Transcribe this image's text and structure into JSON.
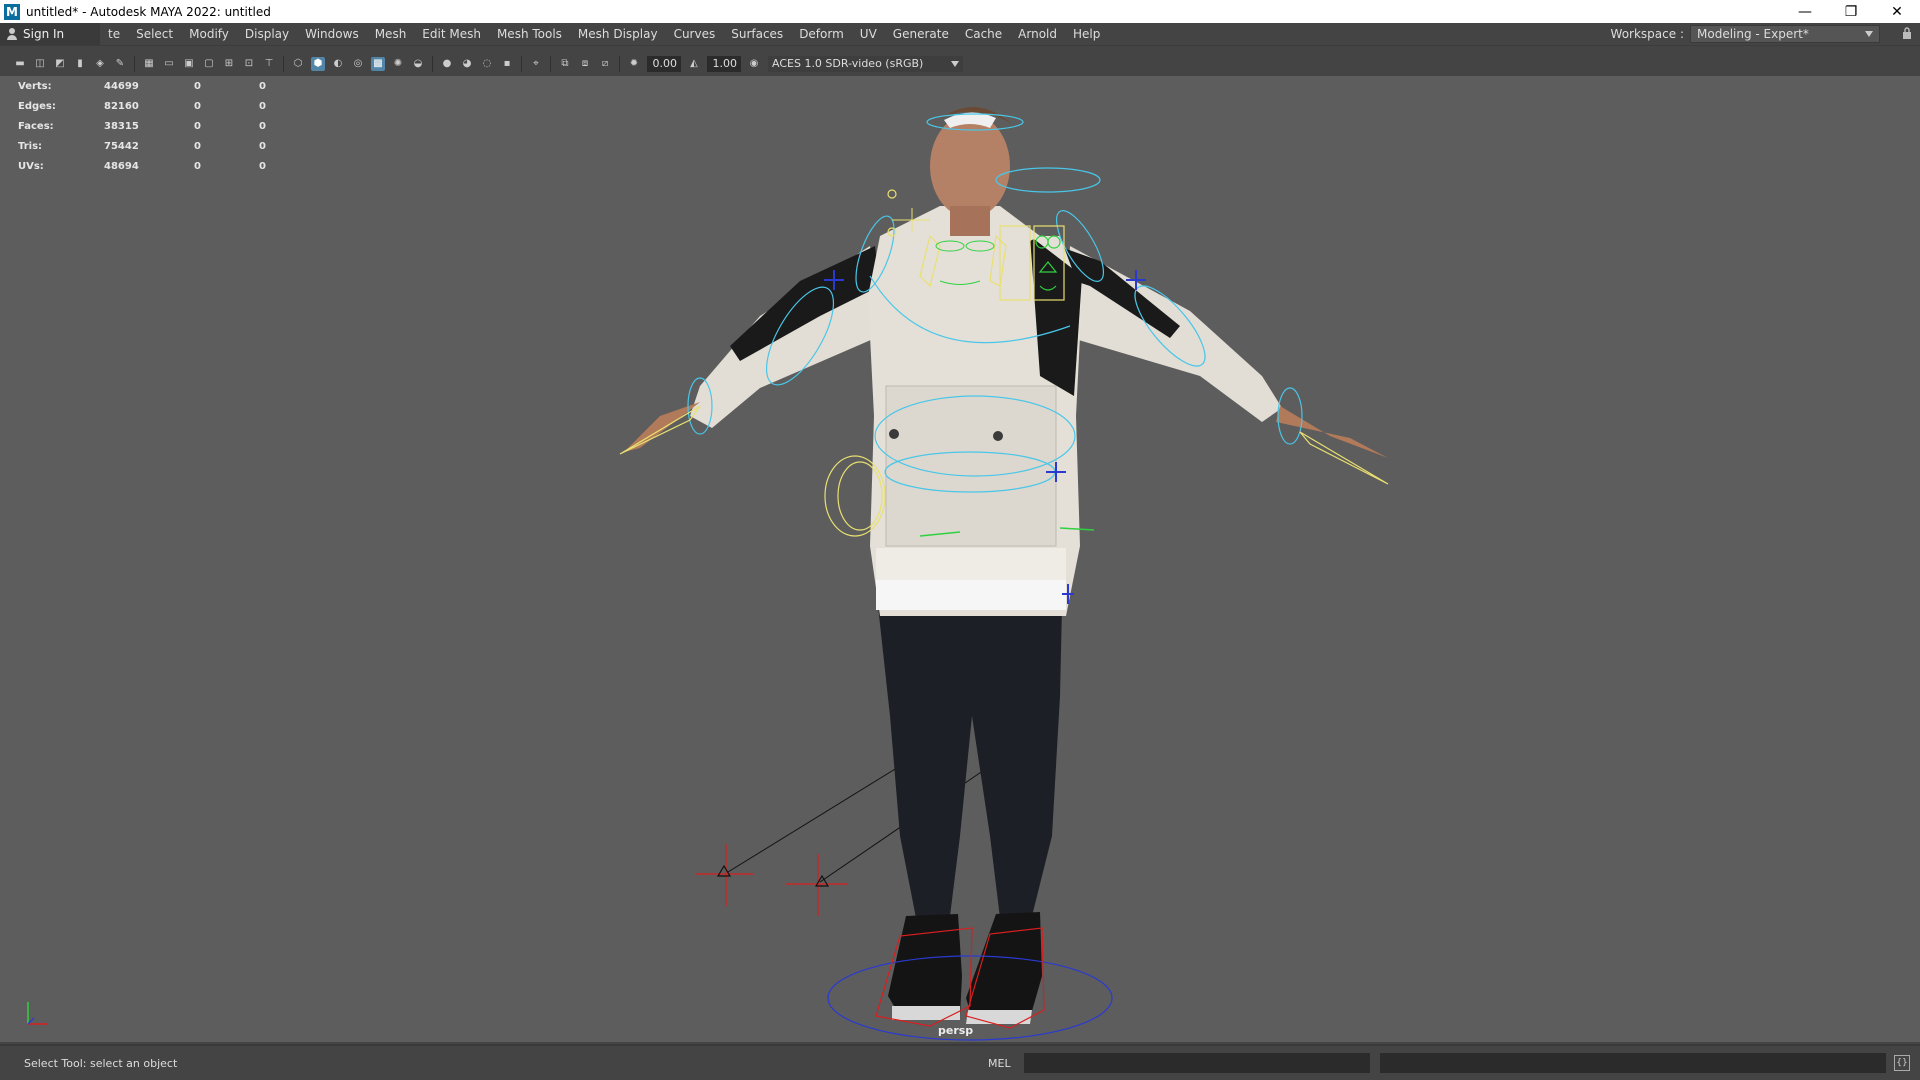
{
  "window": {
    "title": "untitled* - Autodesk MAYA 2022: untitled",
    "icon_glyph": "M",
    "minimize": "—",
    "restore": "❐",
    "close": "✕"
  },
  "menubar": {
    "sign_in": "Sign In",
    "items": [
      "te",
      "Select",
      "Modify",
      "Display",
      "Windows",
      "Mesh",
      "Edit Mesh",
      "Mesh Tools",
      "Mesh Display",
      "Curves",
      "Surfaces",
      "Deform",
      "UV",
      "Generate",
      "Cache",
      "Arnold",
      "Help"
    ],
    "workspace_label": "Workspace :",
    "workspace_value": "Modeling - Expert*"
  },
  "toolbar": {
    "exposure": "0.00",
    "gamma": "1.00",
    "color_space": "ACES 1.0 SDR-video (sRGB)"
  },
  "hud": {
    "rows": [
      {
        "label": "Verts:",
        "v1": "44699",
        "v2": "0",
        "v3": "0"
      },
      {
        "label": "Edges:",
        "v1": "82160",
        "v2": "0",
        "v3": "0"
      },
      {
        "label": "Faces:",
        "v1": "38315",
        "v2": "0",
        "v3": "0"
      },
      {
        "label": "Tris:",
        "v1": "75442",
        "v2": "0",
        "v3": "0"
      },
      {
        "label": "UVs:",
        "v1": "48694",
        "v2": "0",
        "v3": "0"
      }
    ]
  },
  "viewport": {
    "camera_label": "persp",
    "background_color": "#5d5d5d"
  },
  "statusbar": {
    "help_line": "Select Tool: select an object",
    "command_type": "MEL"
  },
  "colors": {
    "accent": "#5285a6",
    "rig_yellow": "#e8e070",
    "rig_cyan": "#49c6e8",
    "rig_blue": "#2a3ad0",
    "rig_red": "#d81f1f",
    "rig_green": "#30d040"
  }
}
